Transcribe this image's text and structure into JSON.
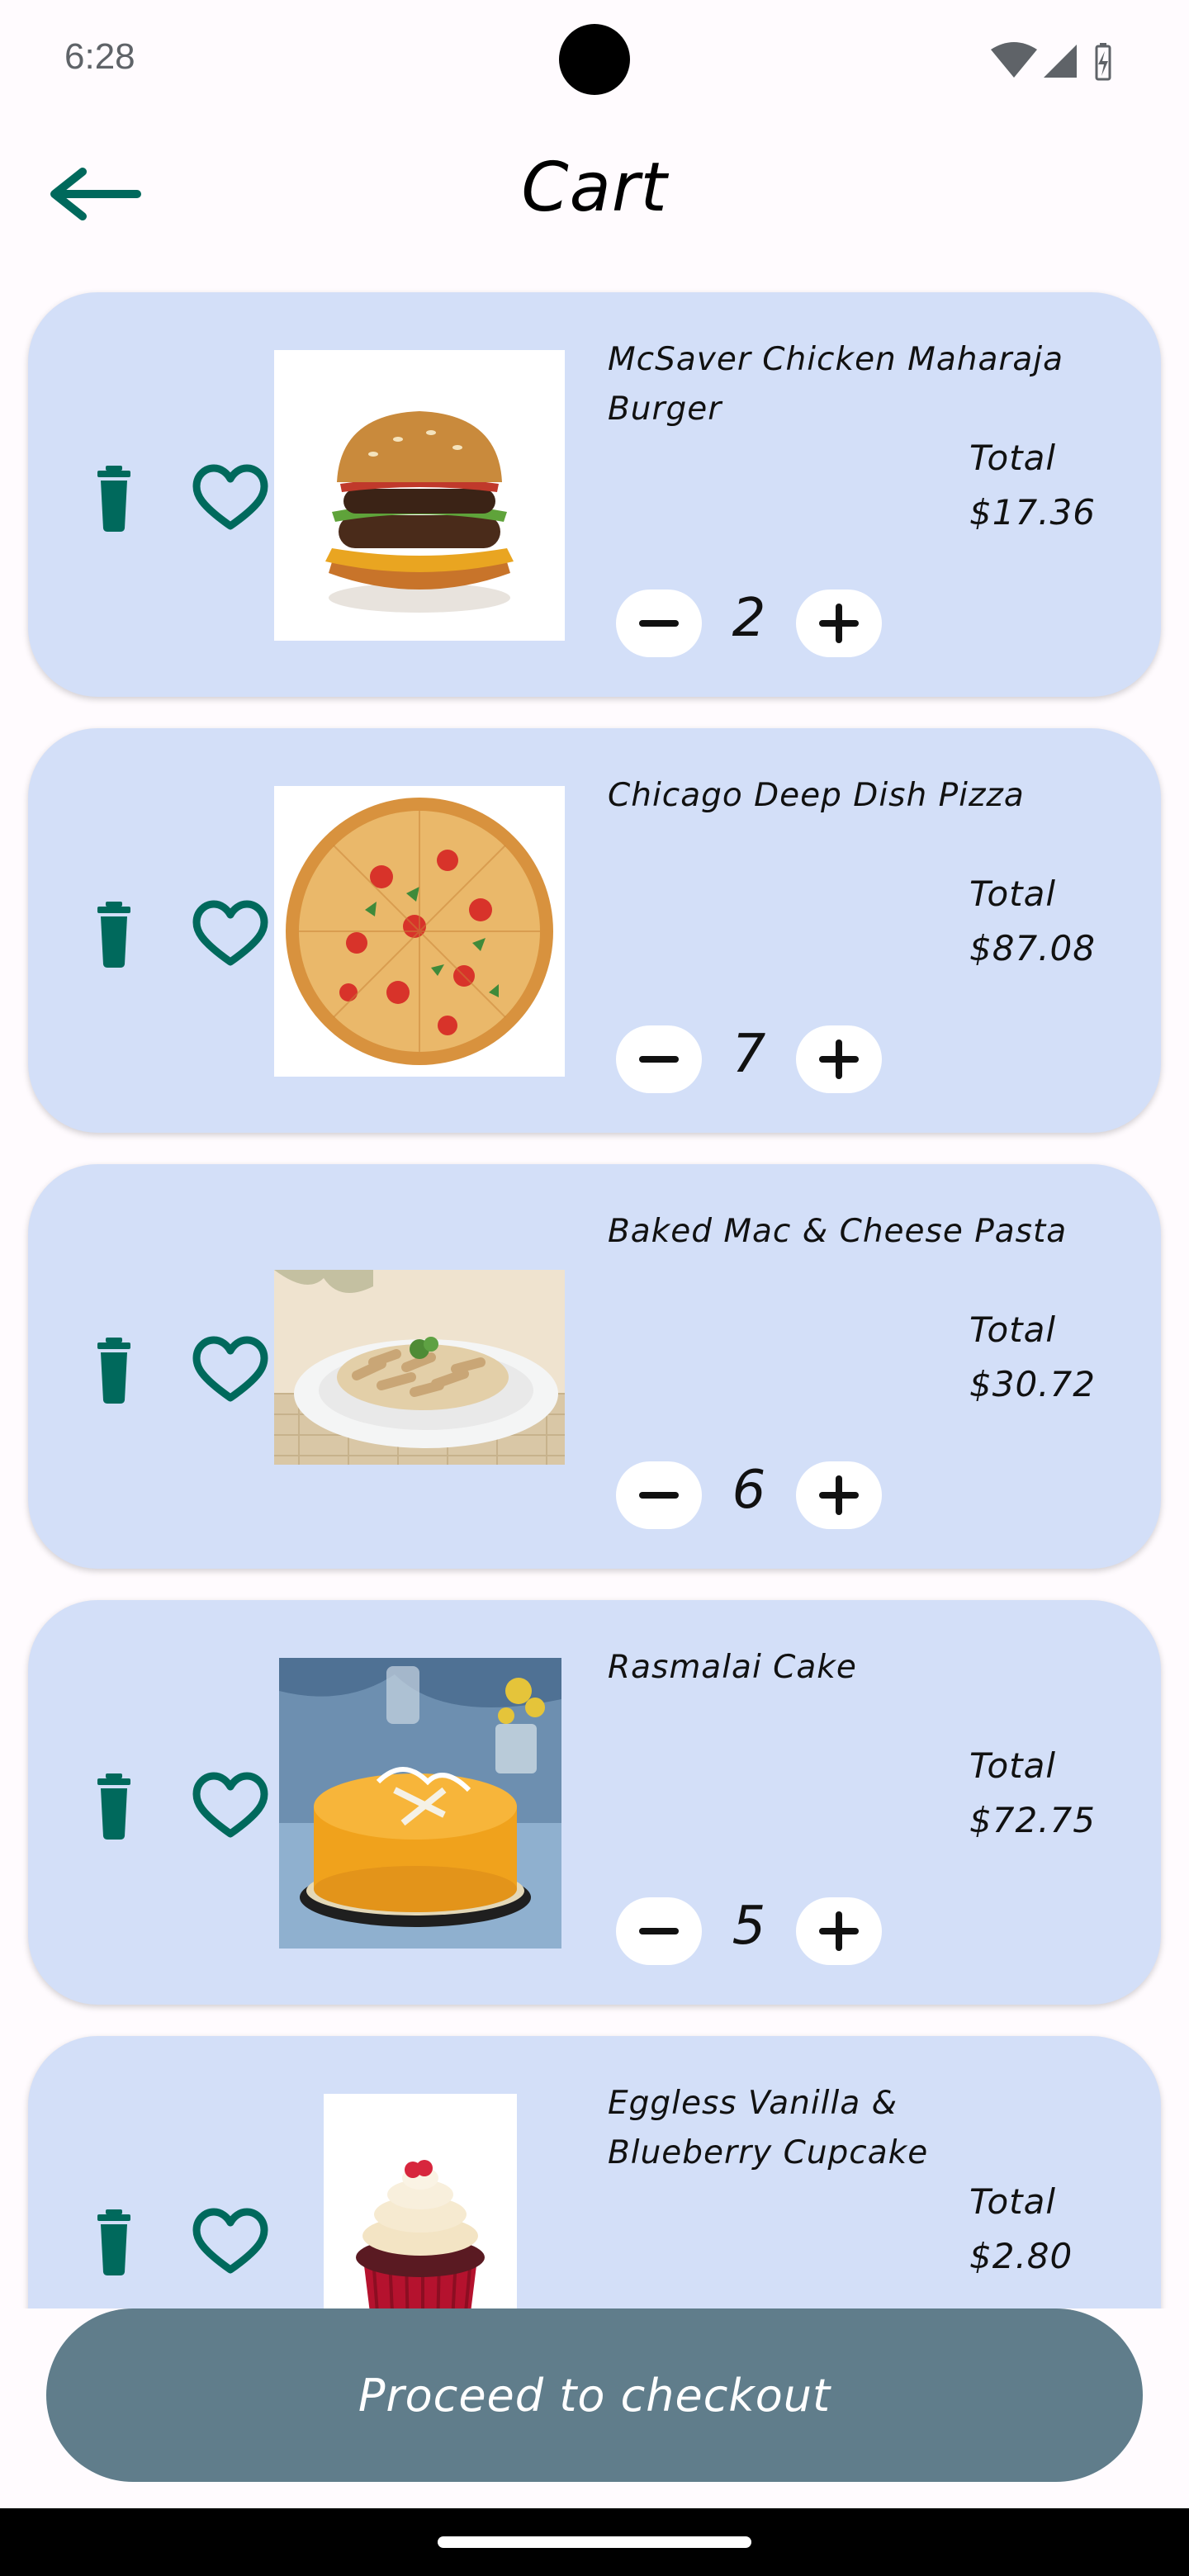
{
  "status_bar": {
    "time": "6:28"
  },
  "header": {
    "title": "Cart",
    "back_icon": "arrow-left-icon"
  },
  "colors": {
    "card_background": "#d3dff8",
    "icon_teal": "#00695c",
    "checkout_button": "#607d8b",
    "page_background": "#fffbfe"
  },
  "cart_items": [
    {
      "name": "McSaver Chicken Maharaja Burger",
      "total_label": "Total",
      "total": "$17.36",
      "quantity": "2",
      "image": "burger"
    },
    {
      "name": "Chicago Deep Dish Pizza",
      "total_label": "Total",
      "total": "$87.08",
      "quantity": "7",
      "image": "pizza"
    },
    {
      "name": "Baked Mac & Cheese Pasta",
      "total_label": "Total",
      "total": "$30.72",
      "quantity": "6",
      "image": "pasta"
    },
    {
      "name": "Rasmalai Cake",
      "total_label": "Total",
      "total": "$72.75",
      "quantity": "5",
      "image": "cake"
    },
    {
      "name": "Eggless Vanilla & Blueberry Cupcake",
      "total_label": "Total",
      "total": "$2.80",
      "quantity": "",
      "image": "cupcake"
    }
  ],
  "checkout": {
    "label": "Proceed to checkout"
  }
}
